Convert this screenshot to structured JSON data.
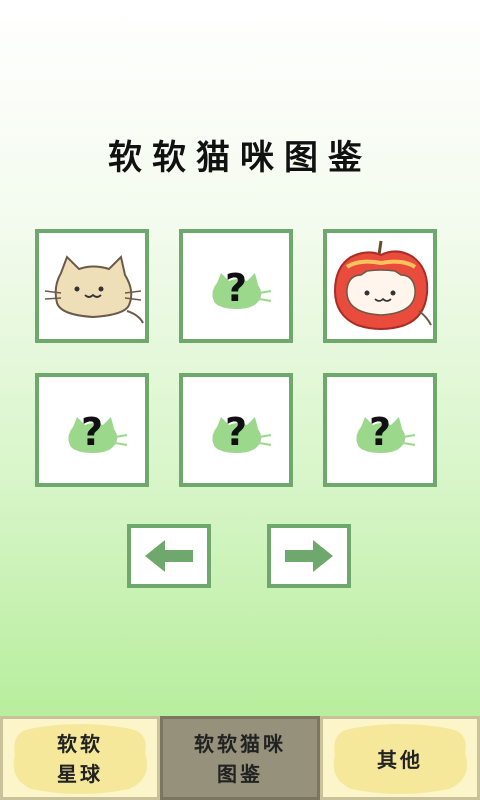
{
  "page": {
    "title": "软软猫咪图鉴"
  },
  "collection": {
    "cards": [
      {
        "state": "unlocked",
        "icon": "beige-cat-icon"
      },
      {
        "state": "locked",
        "icon": "unknown-cat-silhouette-icon",
        "mark": "?"
      },
      {
        "state": "unlocked",
        "icon": "apple-cat-icon"
      },
      {
        "state": "locked",
        "icon": "unknown-cat-silhouette-icon",
        "mark": "?"
      },
      {
        "state": "locked",
        "icon": "unknown-cat-silhouette-icon",
        "mark": "?"
      },
      {
        "state": "locked",
        "icon": "unknown-cat-silhouette-icon",
        "mark": "?"
      }
    ]
  },
  "pager": {
    "prev_icon": "arrow-left-icon",
    "next_icon": "arrow-right-icon"
  },
  "tabs": [
    {
      "line1": "软软",
      "line2": "星球",
      "active": false
    },
    {
      "line1": "软软猫咪",
      "line2": "图鉴",
      "active": true
    },
    {
      "line1": "其他",
      "line2": "",
      "active": false
    }
  ],
  "colors": {
    "card_border": "#6fa86c",
    "silhouette": "#9bd88c",
    "arrow": "#6fa86c",
    "tab_bg": "#fbf5c9",
    "tab_active_bg": "#96917a",
    "tab_blob": "#f6e89b"
  }
}
